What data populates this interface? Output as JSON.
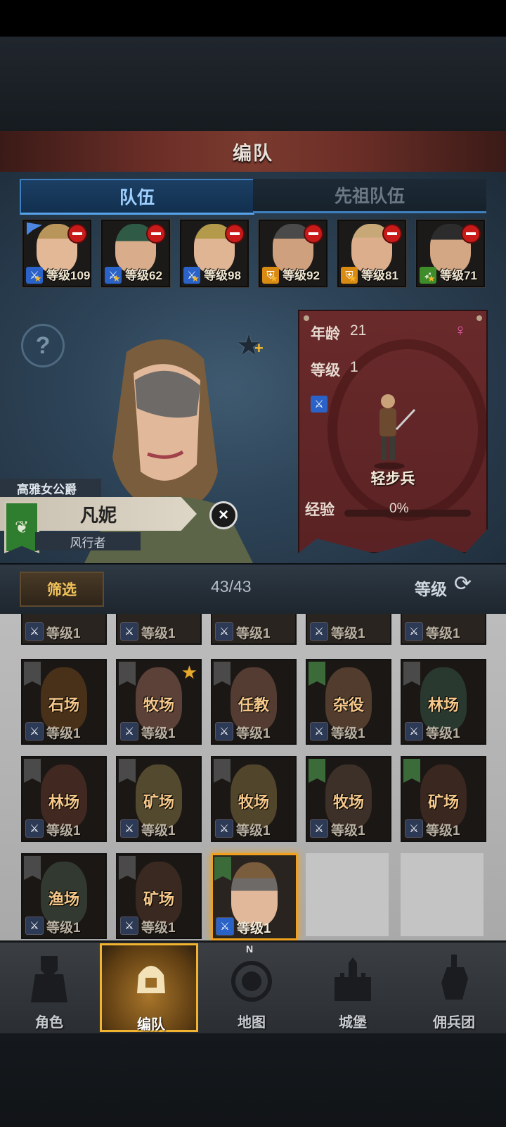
{
  "header": {
    "title": "编队"
  },
  "tabs": [
    {
      "label": "队伍",
      "active": true
    },
    {
      "label": "先祖队伍",
      "active": false
    }
  ],
  "team": [
    {
      "level": "等级109",
      "class_icon": "sword-icon",
      "color": "blue"
    },
    {
      "level": "等级62",
      "class_icon": "sword-icon",
      "color": "blue"
    },
    {
      "level": "等级98",
      "class_icon": "sword-icon",
      "color": "blue"
    },
    {
      "level": "等级92",
      "class_icon": "shield-icon",
      "color": "orange"
    },
    {
      "level": "等级81",
      "class_icon": "shield-icon",
      "color": "orange"
    },
    {
      "level": "等级71",
      "class_icon": "bow-icon",
      "color": "green"
    }
  ],
  "character": {
    "title": "高雅女公爵",
    "name": "凡妮",
    "subtitle": "风行者"
  },
  "info": {
    "age_label": "年龄",
    "age": "21",
    "level_label": "等级",
    "level": "1",
    "class_name": "轻步兵",
    "exp_label": "经验",
    "exp": "0%",
    "gender_icon": "female-icon",
    "colors": {
      "card": "#5e2426",
      "accent": "#f0a21e"
    }
  },
  "filter": {
    "button": "筛选",
    "count": "43/43",
    "sort_label": "等级"
  },
  "roster_partial": [
    "等级1",
    "等级1",
    "等级1",
    "等级1",
    "等级1"
  ],
  "roster": [
    {
      "job": "石场",
      "level": "等级1"
    },
    {
      "job": "牧场",
      "level": "等级1",
      "star": true
    },
    {
      "job": "任教",
      "level": "等级1"
    },
    {
      "job": "杂役",
      "level": "等级1",
      "green_tag": true
    },
    {
      "job": "林场",
      "level": "等级1"
    },
    {
      "job": "林场",
      "level": "等级1"
    },
    {
      "job": "矿场",
      "level": "等级1"
    },
    {
      "job": "牧场",
      "level": "等级1"
    },
    {
      "job": "牧场",
      "level": "等级1",
      "green_tag": true
    },
    {
      "job": "矿场",
      "level": "等级1",
      "green_tag": true
    },
    {
      "job": "渔场",
      "level": "等级1"
    },
    {
      "job": "矿场",
      "level": "等级1"
    },
    {
      "job": "",
      "level": "等级1",
      "selected": true,
      "green_tag": true
    }
  ],
  "nav": [
    {
      "label": "角色",
      "icon": "knight-icon"
    },
    {
      "label": "编队",
      "icon": "helmet-icon",
      "active": true
    },
    {
      "label": "地图",
      "icon": "compass-icon",
      "compass_letter": "N"
    },
    {
      "label": "城堡",
      "icon": "castle-icon"
    },
    {
      "label": "佣兵团",
      "icon": "mercenary-fist-icon"
    }
  ]
}
